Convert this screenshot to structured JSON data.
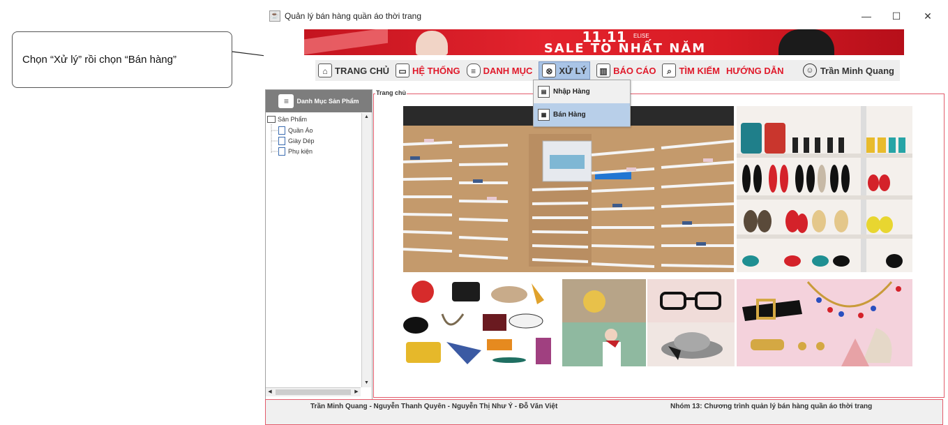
{
  "callout": {
    "text": "Chọn “Xử lý” rồi chọn “Bán hàng”"
  },
  "window": {
    "title": "Quản lý bán hàng quần áo thời trang",
    "controls": {
      "minimize": "—",
      "maximize": "☐",
      "close": "✕"
    }
  },
  "banner": {
    "line1": "11.11",
    "brand": "ELISE",
    "line2": "SALE TO NHẤT NĂM"
  },
  "menu": {
    "items": [
      {
        "label": "TRANG CHỦ",
        "icon": "home-icon",
        "glyph": "⌂"
      },
      {
        "label": "HỆ THỐNG",
        "icon": "monitor-icon",
        "glyph": "▭"
      },
      {
        "label": "DANH MỤC",
        "icon": "list-icon",
        "glyph": "≡"
      },
      {
        "label": "XỬ LÝ",
        "icon": "gear-icon",
        "glyph": "⊗"
      },
      {
        "label": "BÁO CÁO",
        "icon": "chart-icon",
        "glyph": "▥"
      },
      {
        "label": "TÌM KIẾM",
        "icon": "search-icon",
        "glyph": "⌕"
      },
      {
        "label": "HƯỚNG DẪN"
      }
    ],
    "user": "Trần Minh Quang"
  },
  "dropdown": {
    "items": [
      {
        "label": "Nhập Hàng",
        "icon": "import-icon"
      },
      {
        "label": "Bán Hàng",
        "icon": "sell-icon"
      }
    ]
  },
  "sidebar": {
    "header": "Danh Mục Sản Phẩm",
    "tree": {
      "root": "Sản Phẩm",
      "children": [
        "Quần Áo",
        "Giày Dép",
        "Phụ kiện"
      ]
    }
  },
  "main": {
    "group_label": "Trang chủ"
  },
  "footer": {
    "authors": "Trần Minh Quang - Nguyễn Thanh Quyên - Nguyễn Thị Như Ý - Đỗ Văn Việt",
    "project": "Nhóm 13: Chương trình quản lý bán hàng quần áo thời trang"
  },
  "colors": {
    "accent_red": "#e0192a",
    "selection": "#a9c4e6",
    "frame_border": "#e35b6b"
  }
}
